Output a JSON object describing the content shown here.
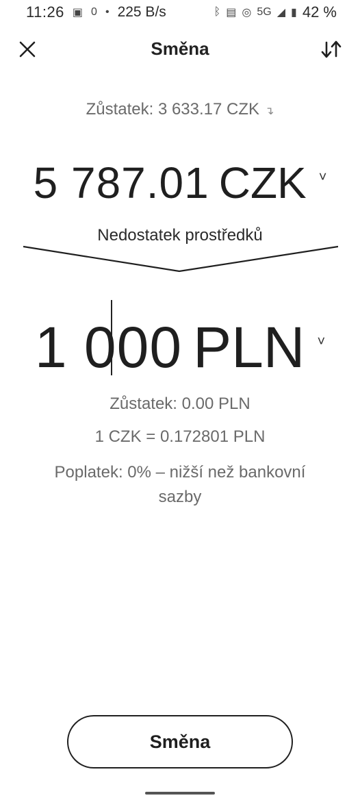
{
  "status_bar": {
    "time": "11:26",
    "notification_count": "0",
    "network_speed": "225 B/s",
    "signal_label": "5G",
    "battery_text": "42 %"
  },
  "header": {
    "title": "Směna"
  },
  "from": {
    "balance_label": "Zůstatek: 3 633.17 CZK",
    "amount": "5 787.01",
    "currency": "CZK"
  },
  "warning": "Nedostatek prostředků",
  "to": {
    "amount": "1 000",
    "currency": "PLN",
    "balance_label": "Zůstatek: 0.00 PLN"
  },
  "rate_text": "1 CZK = 0.172801 PLN",
  "fee_text": "Poplatek: 0% – nižší než bankovní sazby",
  "exchange_button_label": "Směna"
}
